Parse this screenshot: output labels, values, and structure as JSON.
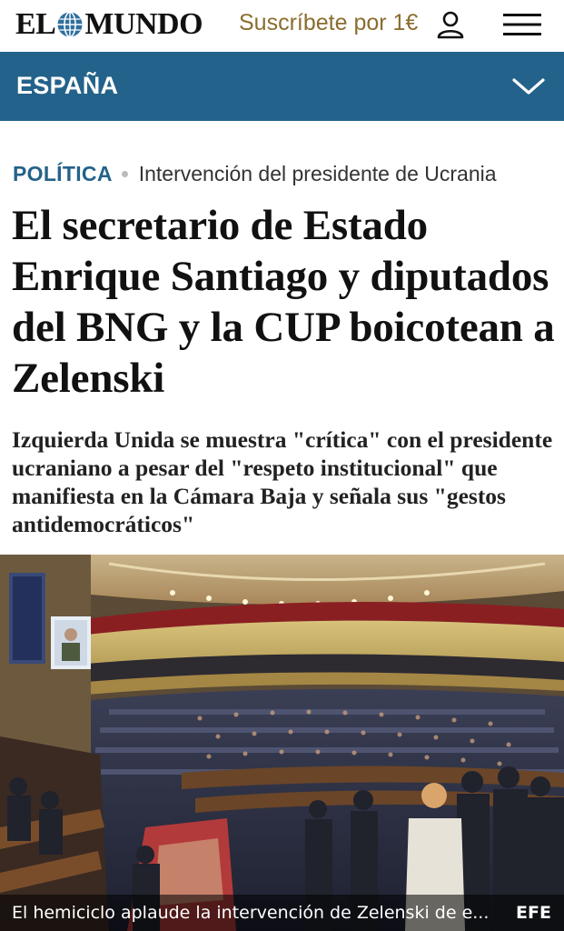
{
  "header": {
    "logo_left": "EL",
    "logo_right": "MUNDO",
    "logo_globe_icon": "globe-icon",
    "subscribe_label": "Suscríbete por 1€",
    "user_icon": "user-icon",
    "menu_icon": "hamburger-menu-icon",
    "brand_color": "#8a6d2f"
  },
  "section_bar": {
    "label": "ESPAÑA",
    "chevron_icon": "chevron-down-icon",
    "color": "#23628a"
  },
  "article": {
    "category": "POLÍTICA",
    "topic": "Intervención del presidente de Ucrania",
    "headline": "El secretario de Estado Enrique Santiago y diputados del BNG y la CUP boicotean a Zelenski",
    "standfirst": "Izquierda Unida se muestra \"crítica\" con el presidente ucraniano a pesar del \"respeto institucional\" que manifiesta en la Cámara Baja y señala sus \"gestos antidemocráticos\""
  },
  "photo": {
    "caption": "El hemiciclo aplaude la intervención de Zelenski de e...",
    "credit": "EFE"
  }
}
